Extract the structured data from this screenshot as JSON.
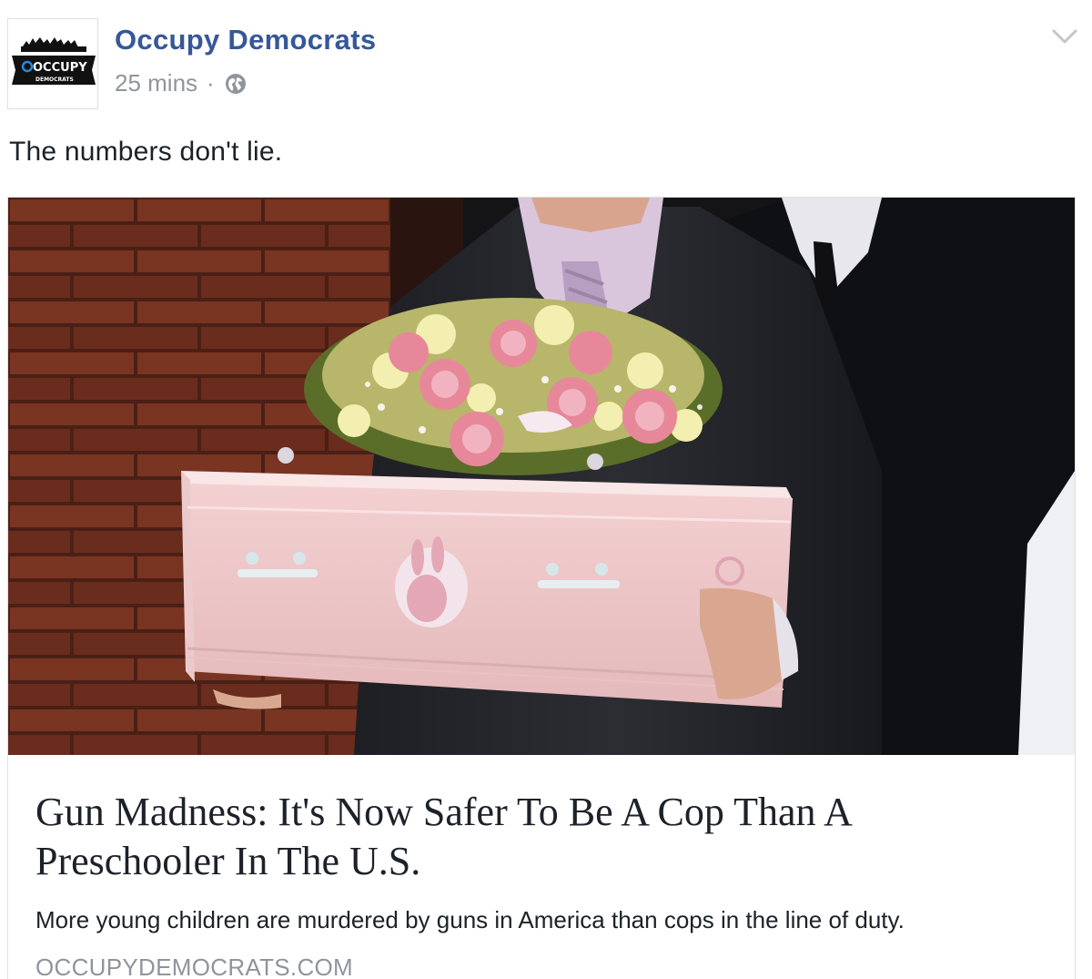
{
  "post": {
    "author": "Occupy Democrats",
    "avatar_logo_text": "OCCUPY",
    "avatar_logo_subtext": "DEMOCRATS",
    "timestamp": "25 mins",
    "separator": "·",
    "privacy_icon": "globe-icon",
    "menu_icon": "chevron-down-icon",
    "caption": "The numbers don't lie."
  },
  "link_card": {
    "title": "Gun Madness: It's Now Safer To Be A Cop Than A Preschooler In The U.S.",
    "description": "More young children are murdered by guns in America than cops in the line of duty.",
    "domain": "OCCUPYDEMOCRATS.COM"
  },
  "colors": {
    "link_blue": "#365899",
    "meta_gray": "#90949c",
    "text": "#1d2129",
    "border": "#dddfe2"
  }
}
